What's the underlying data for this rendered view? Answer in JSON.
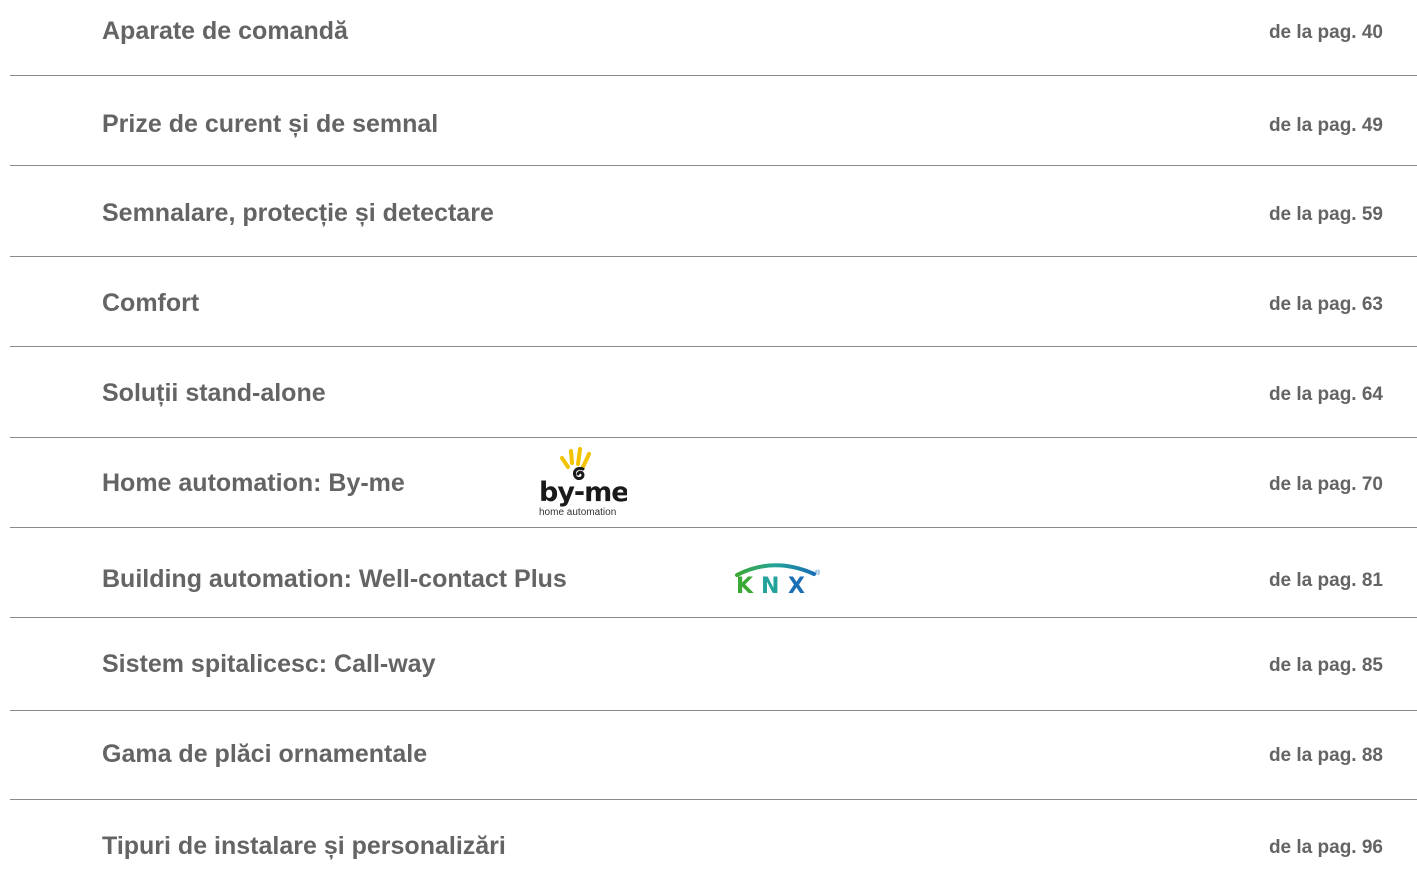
{
  "toc": {
    "items": [
      {
        "title": "Aparate de comandă",
        "page": "de la pag. 40"
      },
      {
        "title": "Prize de curent și de semnal",
        "page": "de la pag. 49"
      },
      {
        "title": "Semnalare, protecție și detectare",
        "page": "de la pag. 59"
      },
      {
        "title": "Comfort",
        "page": "de la pag. 63"
      },
      {
        "title": "Soluții stand-alone",
        "page": "de la pag. 64"
      },
      {
        "title": "Home automation: By-me",
        "page": "de la pag. 70"
      },
      {
        "title": "Building automation: Well-contact Plus",
        "page": "de la pag. 81"
      },
      {
        "title": "Sistem spitalicesc: Call-way",
        "page": "de la pag. 85"
      },
      {
        "title": "Gama de plăci ornamentale",
        "page": "de la pag. 88"
      },
      {
        "title": "Tipuri de instalare și personalizări",
        "page": "de la pag. 96"
      }
    ]
  },
  "logos": {
    "byme": {
      "wordmark": "by-me",
      "tagline": "home automation",
      "icon": "hand-sun-icon"
    },
    "knx": {
      "wordmark": "KNX",
      "mark": "®",
      "icon": "knx-logo-icon"
    }
  },
  "colors": {
    "text": "#646464",
    "divider": "#8a8a8a",
    "knx_green": "#3aa935",
    "knx_blue": "#1a6fb5",
    "byme_yellow": "#f2c300"
  }
}
